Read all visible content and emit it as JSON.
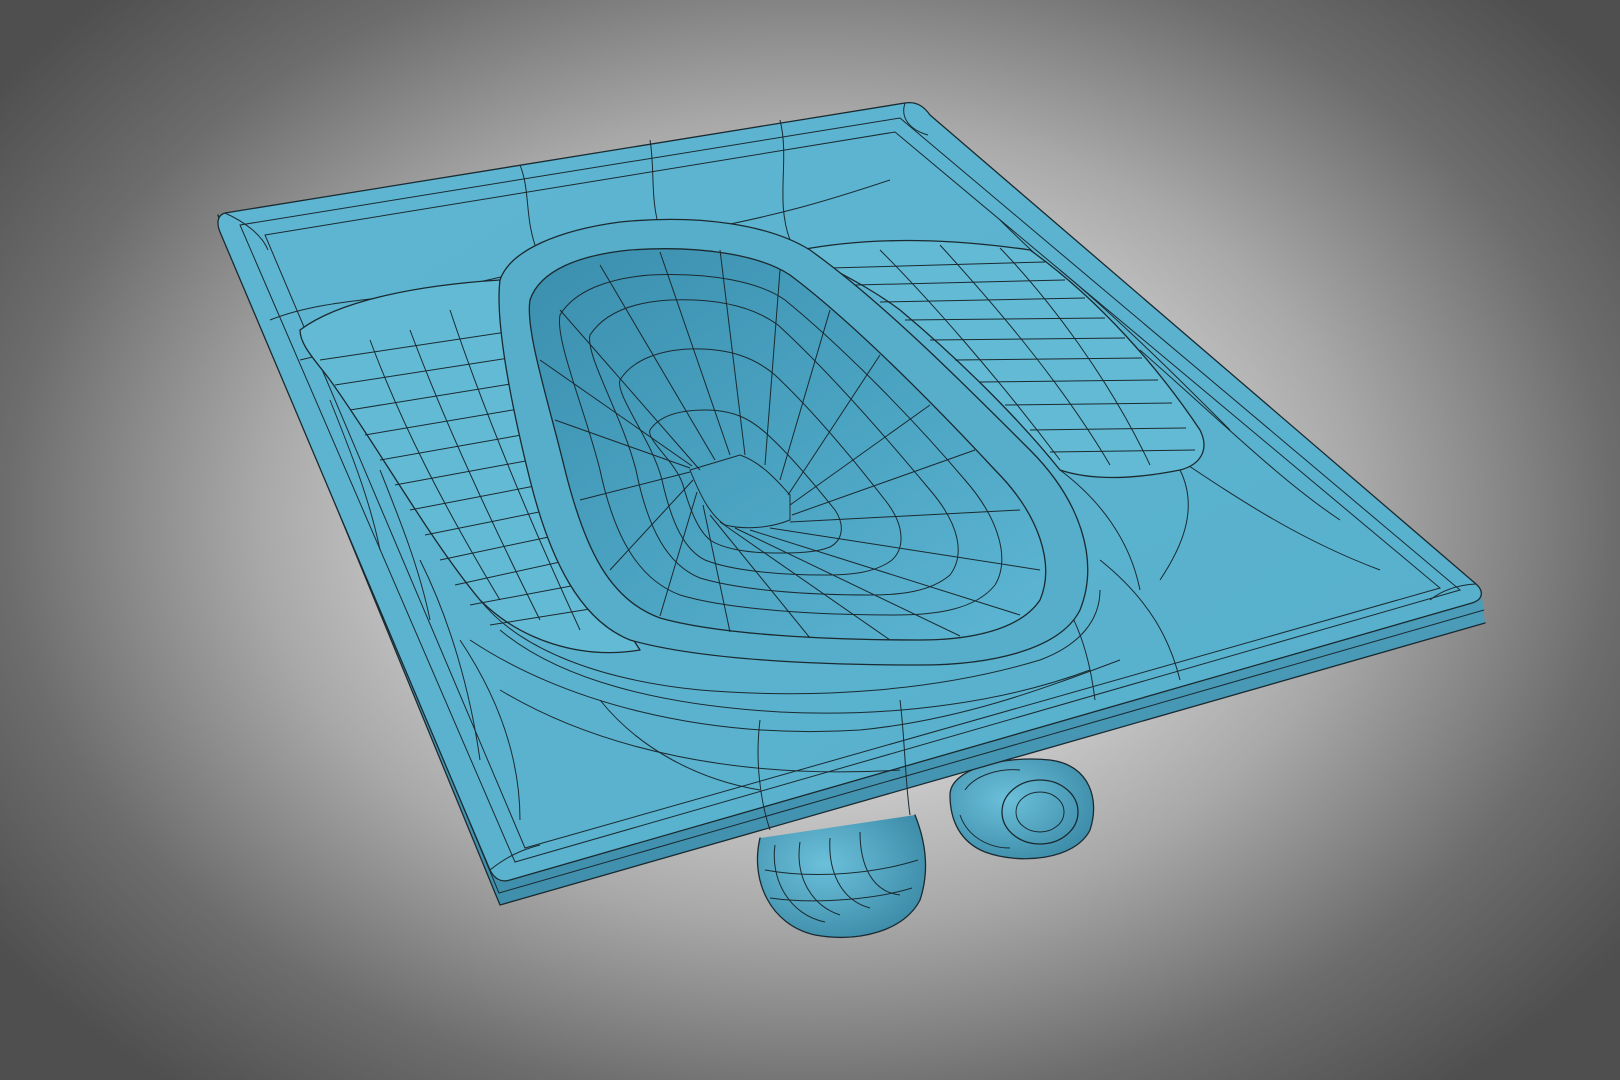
{
  "scene": {
    "subject_icon": "squat-toilet-model-icon",
    "colors": {
      "background_center": "#f2f2f2",
      "background_edge": "#4f4f4f",
      "model_surface": "#5bb3cf",
      "model_shadow": "#3f94b3",
      "model_highlight": "#7cc9e0",
      "wireframe": "#1a2a30"
    }
  }
}
